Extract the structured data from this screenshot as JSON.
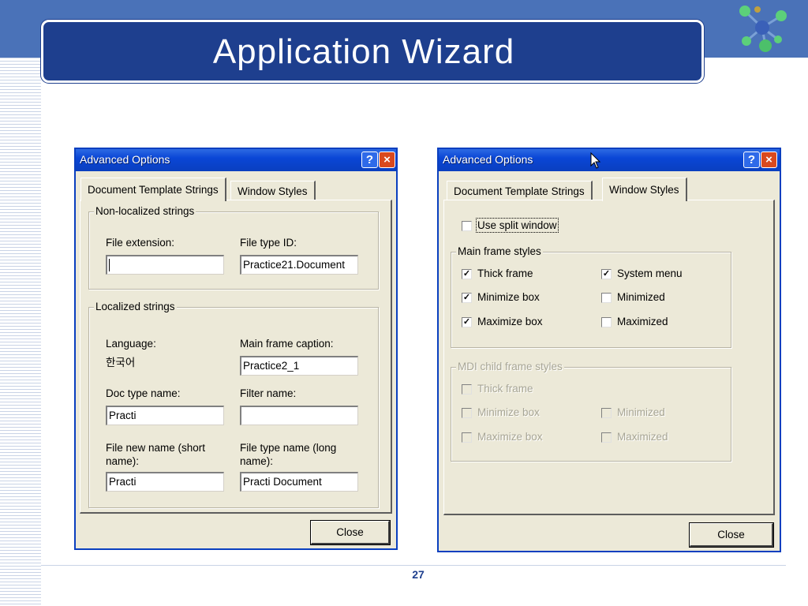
{
  "slide": {
    "title": "Application Wizard",
    "page_number": "27"
  },
  "colors": {
    "slide_band": "#4a72b8",
    "title_box": "#1e3f8e",
    "dialog_face": "#ece9d8",
    "titlebar": "#0a46d6",
    "close_red": "#d9491e"
  },
  "dialog_left": {
    "title": "Advanced Options",
    "help_icon": "?",
    "close_icon": "×",
    "tabs": [
      "Document Template Strings",
      "Window Styles"
    ],
    "group_nonlocalized": "Non-localized strings",
    "file_extension_label": "File extension:",
    "file_extension_value": "",
    "file_type_id_label": "File type ID:",
    "file_type_id_value": "Practice21.Document",
    "group_localized": "Localized strings",
    "language_label": "Language:",
    "language_value": "한국어",
    "main_frame_caption_label": "Main frame caption:",
    "main_frame_caption_value": "Practice2_1",
    "doc_type_name_label": "Doc type name:",
    "doc_type_name_value": "Practi",
    "filter_name_label": "Filter name:",
    "filter_name_value": "",
    "file_new_name_label_1": "File new name (short",
    "file_new_name_label_2": "name):",
    "file_new_name_value": "Practi",
    "file_type_name_label_1": "File type name (long",
    "file_type_name_label_2": "name):",
    "file_type_name_value": "Practi Document",
    "close_button": "Close"
  },
  "dialog_right": {
    "title": "Advanced Options",
    "help_icon": "?",
    "close_icon": "×",
    "tabs": [
      "Document Template Strings",
      "Window Styles"
    ],
    "use_split_window": {
      "label": "Use split window",
      "checked": false
    },
    "group_main_frame": "Main frame styles",
    "main_frame_styles": [
      {
        "label": "Thick frame",
        "checked": true
      },
      {
        "label": "System menu",
        "checked": true
      },
      {
        "label": "Minimize box",
        "checked": true
      },
      {
        "label": "Minimized",
        "checked": false
      },
      {
        "label": "Maximize box",
        "checked": true
      },
      {
        "label": "Maximized",
        "checked": false
      }
    ],
    "group_mdi_child": "MDI child frame styles",
    "mdi_child_styles": [
      {
        "label": "Thick frame",
        "checked": false
      },
      {
        "label": "Minimize box",
        "checked": false
      },
      {
        "label": "Minimized",
        "checked": false
      },
      {
        "label": "Maximize box",
        "checked": false
      },
      {
        "label": "Maximized",
        "checked": false
      }
    ],
    "close_button": "Close"
  }
}
